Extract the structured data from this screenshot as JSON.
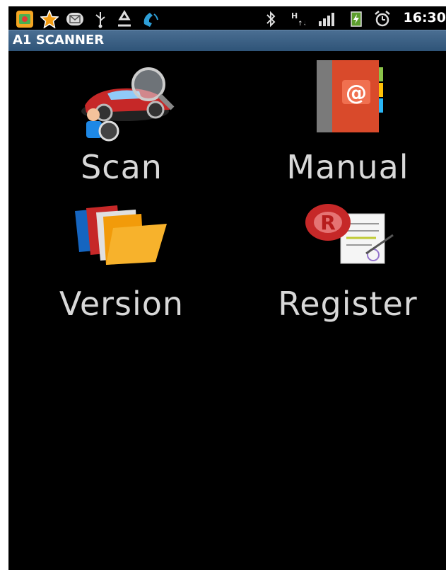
{
  "statusbar": {
    "left_icons": [
      "app-icon",
      "star-icon",
      "mail-icon",
      "usb-icon",
      "recycle-icon",
      "phone-icon"
    ],
    "right_icons": [
      "bluetooth-icon",
      "hsdpa-icon",
      "signal-icon",
      "battery-icon",
      "alarm-icon"
    ],
    "time": "16:30"
  },
  "titlebar": {
    "title": "A1 SCANNER"
  },
  "menu": {
    "items": [
      {
        "label": "Scan",
        "icon": "car-scan-icon"
      },
      {
        "label": "Manual",
        "icon": "address-book-icon"
      },
      {
        "label": "Version",
        "icon": "folders-icon"
      },
      {
        "label": "Register",
        "icon": "registered-document-icon"
      }
    ]
  }
}
